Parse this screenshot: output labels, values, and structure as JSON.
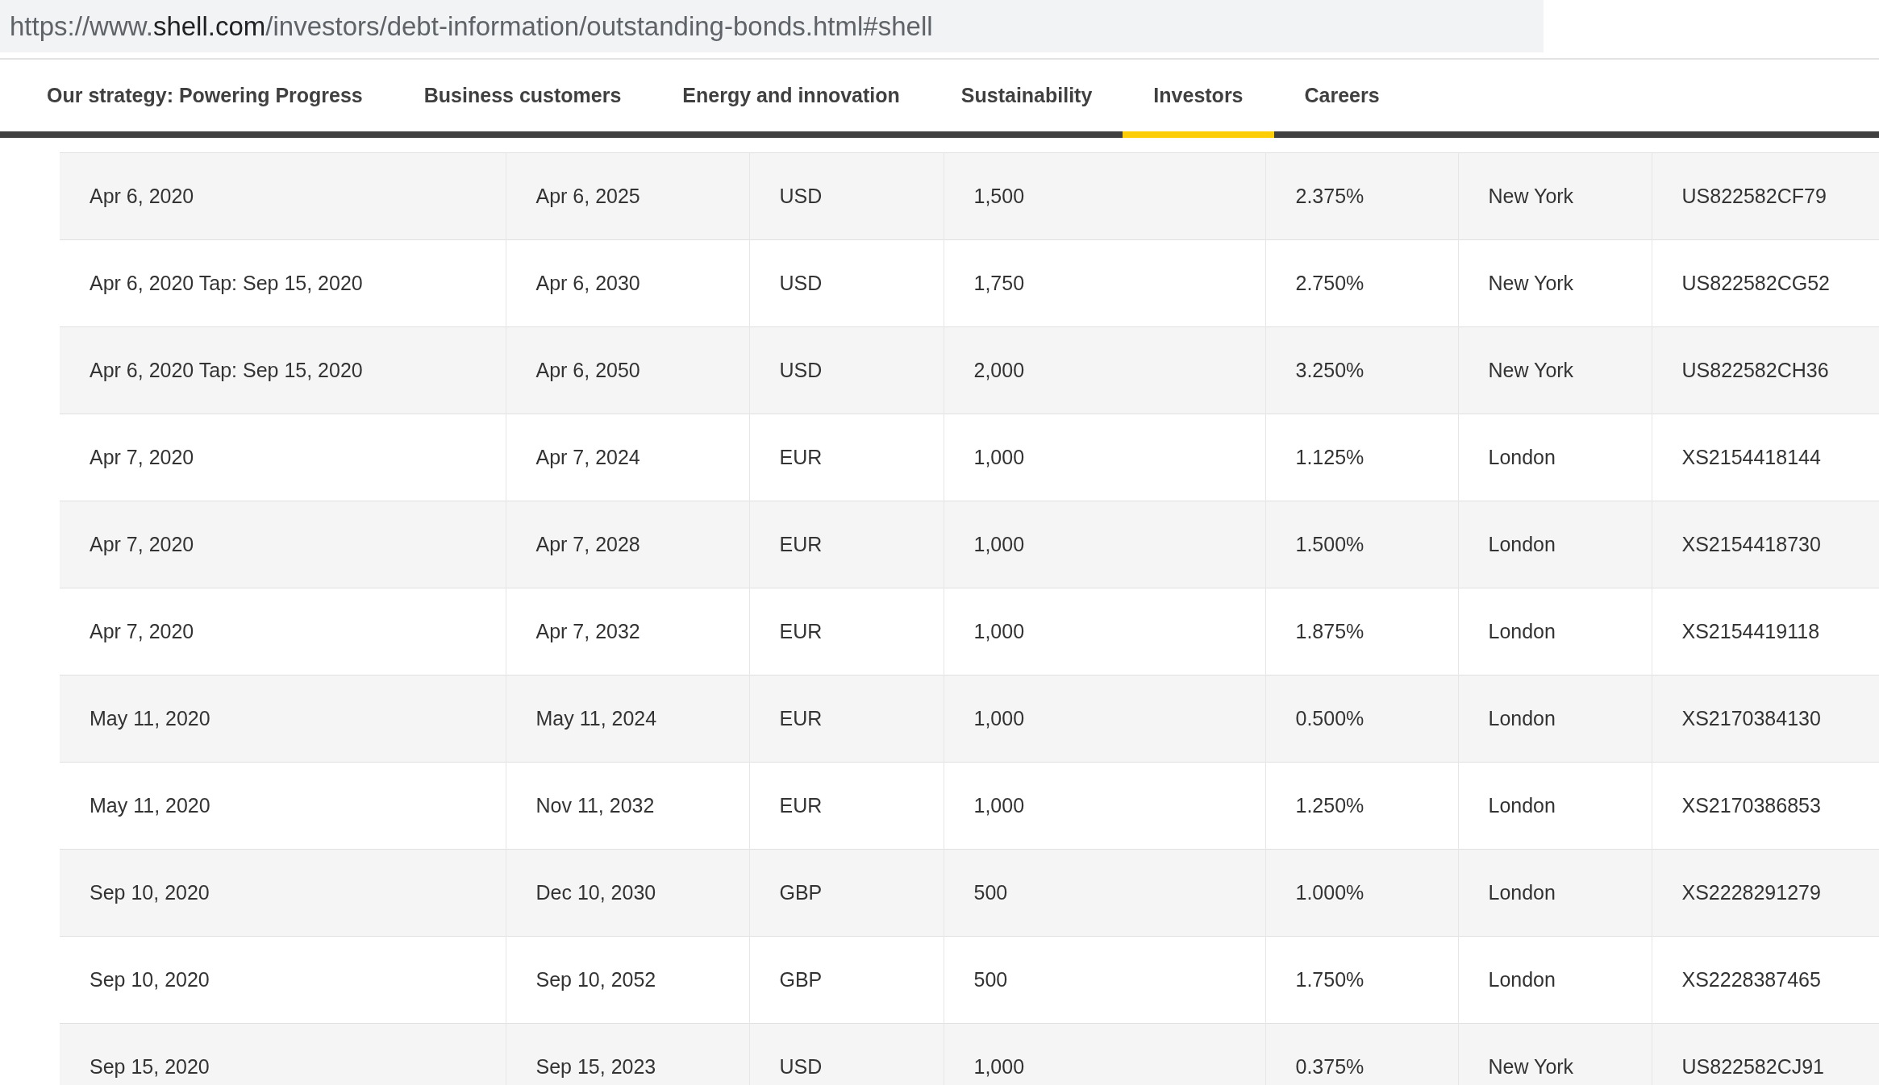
{
  "address_bar": {
    "url_prefix": "https://www.",
    "url_domain": "shell.com",
    "url_path": "/investors/debt-information/outstanding-bonds.html#shell"
  },
  "nav": {
    "tabs": [
      {
        "label": "Our strategy: Powering Progress",
        "selected": false
      },
      {
        "label": "Business customers",
        "selected": false
      },
      {
        "label": "Energy and innovation",
        "selected": false
      },
      {
        "label": "Sustainability",
        "selected": false
      },
      {
        "label": "Investors",
        "selected": true
      },
      {
        "label": "Careers",
        "selected": false
      }
    ]
  },
  "table": {
    "rows": [
      [
        "Apr 6, 2020",
        "Apr 6, 2025",
        "USD",
        "1,500",
        "2.375%",
        "New York",
        "US822582CF79"
      ],
      [
        "Apr 6, 2020 Tap: Sep 15, 2020",
        "Apr 6, 2030",
        "USD",
        "1,750",
        "2.750%",
        "New York",
        "US822582CG52"
      ],
      [
        "Apr 6, 2020 Tap: Sep 15, 2020",
        "Apr 6, 2050",
        "USD",
        "2,000",
        "3.250%",
        "New York",
        "US822582CH36"
      ],
      [
        "Apr 7, 2020",
        "Apr 7, 2024",
        "EUR",
        "1,000",
        "1.125%",
        "London",
        "XS2154418144"
      ],
      [
        "Apr 7, 2020",
        "Apr 7, 2028",
        "EUR",
        "1,000",
        "1.500%",
        "London",
        "XS2154418730"
      ],
      [
        "Apr 7, 2020",
        "Apr 7, 2032",
        "EUR",
        "1,000",
        "1.875%",
        "London",
        "XS2154419118"
      ],
      [
        "May 11, 2020",
        "May 11, 2024",
        "EUR",
        "1,000",
        "0.500%",
        "London",
        "XS2170384130"
      ],
      [
        "May 11, 2020",
        "Nov 11, 2032",
        "EUR",
        "1,000",
        "1.250%",
        "London",
        "XS2170386853"
      ],
      [
        "Sep 10, 2020",
        "Dec 10, 2030",
        "GBP",
        "500",
        "1.000%",
        "London",
        "XS2228291279"
      ],
      [
        "Sep 10, 2020",
        "Sep 10, 2052",
        "GBP",
        "500",
        "1.750%",
        "London",
        "XS2228387465"
      ],
      [
        "Sep 15, 2020",
        "Sep 15, 2023",
        "USD",
        "1,000",
        "0.375%",
        "New York",
        "US822582CJ91"
      ]
    ]
  }
}
